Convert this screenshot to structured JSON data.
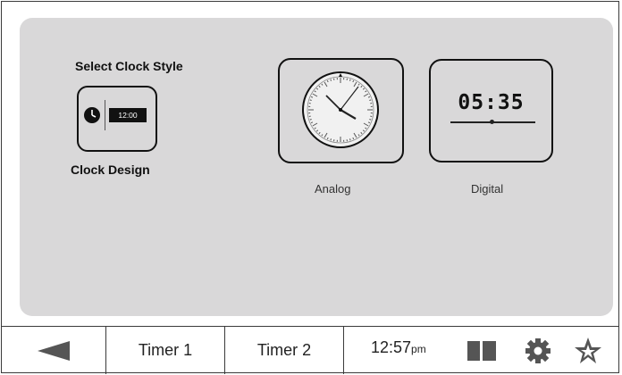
{
  "clock_settings": {
    "heading": "Select Clock Style",
    "design_label": "Clock Design",
    "design_preview_time": "12:00",
    "options": [
      {
        "label": "Analog"
      },
      {
        "label": "Digital",
        "preview_time": "05:35"
      }
    ]
  },
  "bottom_bar": {
    "timer1_label": "Timer 1",
    "timer2_label": "Timer 2",
    "time": "12:57",
    "ampm": "pm",
    "icons": [
      "back-arrow-icon",
      "book-icon",
      "gear-icon",
      "star-icon"
    ]
  }
}
